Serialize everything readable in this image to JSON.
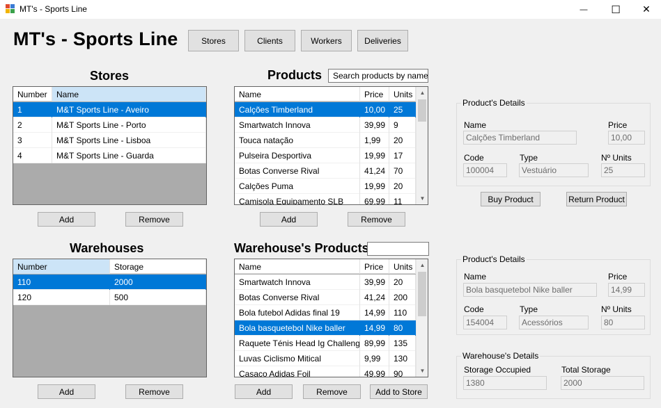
{
  "window": {
    "title": "MT's - Sports Line",
    "minimize_glyph": "—",
    "maximize_glyph": "☐",
    "close_glyph": "✕"
  },
  "header": {
    "app_title": "MT's - Sports Line",
    "nav": [
      "Stores",
      "Clients",
      "Workers",
      "Deliveries"
    ]
  },
  "stores": {
    "heading": "Stores",
    "columns": [
      "Number",
      "Name"
    ],
    "rows": [
      [
        "1",
        "M&T Sports Line - Aveiro"
      ],
      [
        "2",
        "M&T Sports Line - Porto"
      ],
      [
        "3",
        "M&T Sports Line - Lisboa"
      ],
      [
        "4",
        "M&T Sports Line - Guarda"
      ]
    ],
    "add_label": "Add",
    "remove_label": "Remove"
  },
  "products": {
    "heading": "Products",
    "search_placeholder": "Search products by name",
    "columns": [
      "Name",
      "Price",
      "Units"
    ],
    "rows": [
      [
        "Calções Timberland",
        "10,00",
        "25"
      ],
      [
        "Smartwatch Innova",
        "39,99",
        "9"
      ],
      [
        "Touca natação",
        "1,99",
        "20"
      ],
      [
        "Pulseira Desportiva",
        "19,99",
        "17"
      ],
      [
        "Botas Converse Rival",
        "41,24",
        "70"
      ],
      [
        "Calções Puma",
        "19,99",
        "20"
      ],
      [
        "Camisola Equipamento SLB",
        "69,99",
        "11"
      ]
    ],
    "add_label": "Add",
    "remove_label": "Remove"
  },
  "product_details": {
    "group_title": "Product's Details",
    "name_label": "Name",
    "name_value": "Calções Timberland",
    "price_label": "Price",
    "price_value": "10,00",
    "code_label": "Code",
    "code_value": "100004",
    "type_label": "Type",
    "type_value": "Vestuário",
    "units_label": "Nº Units",
    "units_value": "25",
    "buy_label": "Buy Product",
    "return_label": "Return Product"
  },
  "warehouses": {
    "heading": "Warehouses",
    "columns": [
      "Number",
      "Storage"
    ],
    "rows": [
      [
        "110",
        "2000"
      ],
      [
        "120",
        "500"
      ]
    ],
    "add_label": "Add",
    "remove_label": "Remove"
  },
  "warehouse_products": {
    "heading": "Warehouse's Products",
    "search_value": "",
    "columns": [
      "Name",
      "Price",
      "Units"
    ],
    "rows": [
      [
        "Smartwatch Innova",
        "39,99",
        "20"
      ],
      [
        "Botas Converse Rival",
        "41,24",
        "200"
      ],
      [
        "Bola futebol Adidas final 19",
        "14,99",
        "110"
      ],
      [
        "Bola basquetebol Nike baller",
        "14,99",
        "80"
      ],
      [
        "Raquete Ténis Head Ig Challenge...",
        "89,99",
        "135"
      ],
      [
        "Luvas Ciclismo Mitical",
        "9,99",
        "130"
      ],
      [
        "Casaco Adidas Foil",
        "49,99",
        "90"
      ]
    ],
    "add_label": "Add",
    "remove_label": "Remove",
    "add_to_store_label": "Add to Store"
  },
  "wh_product_details": {
    "group_title": "Product's Details",
    "name_label": "Name",
    "name_value": "Bola basquetebol Nike baller",
    "price_label": "Price",
    "price_value": "14,99",
    "code_label": "Code",
    "code_value": "154004",
    "type_label": "Type",
    "type_value": "Acessórios",
    "units_label": "Nº Units",
    "units_value": "80"
  },
  "warehouse_details": {
    "group_title": "Warehouse's Details",
    "occupied_label": "Storage Occupied",
    "occupied_value": "1380",
    "total_label": "Total Storage",
    "total_value": "2000"
  },
  "colors": {
    "selection": "#0078d7",
    "header_active": "#cce4f7",
    "grid_empty": "#ababab",
    "button": "#e1e1e1"
  }
}
